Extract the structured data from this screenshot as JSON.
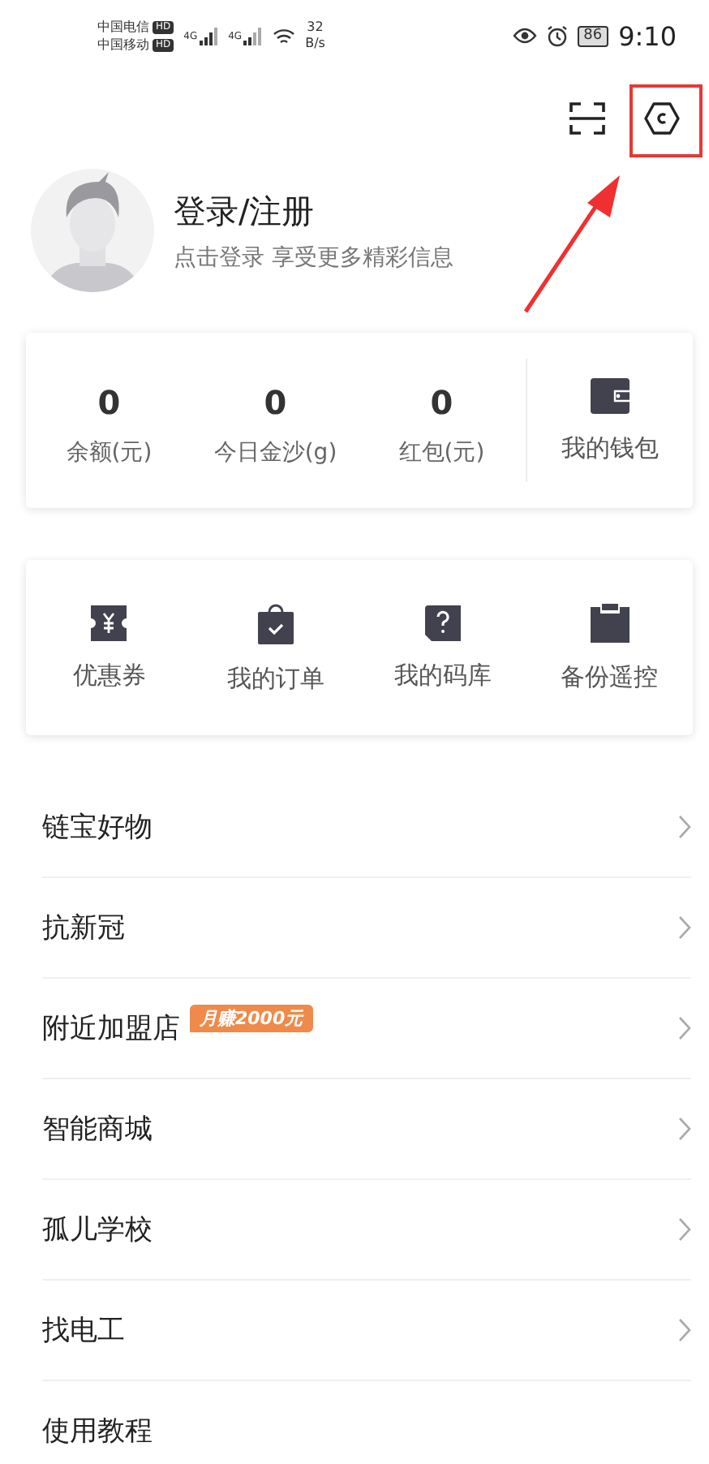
{
  "status_bar": {
    "carriers": [
      {
        "name": "中国电信",
        "badge": "HD"
      },
      {
        "name": "中国移动",
        "badge": "HD"
      }
    ],
    "signals": [
      "4G",
      "4G"
    ],
    "speed_value": "32",
    "speed_unit": "B/s",
    "battery": "86",
    "time": "9:10"
  },
  "profile": {
    "title": "登录/注册",
    "subtitle": "点击登录 享受更多精彩信息"
  },
  "stats": [
    {
      "value": "0",
      "label": "余额(元)"
    },
    {
      "value": "0",
      "label": "今日金沙(g)"
    },
    {
      "value": "0",
      "label": "红包(元)"
    }
  ],
  "wallet": {
    "label": "我的钱包"
  },
  "shortcuts": [
    {
      "kind": "coupon",
      "label": "优惠券"
    },
    {
      "kind": "order",
      "label": "我的订单"
    },
    {
      "kind": "code",
      "label": "我的码库"
    },
    {
      "kind": "backup",
      "label": "备份遥控"
    }
  ],
  "menu": [
    {
      "label": "链宝好物"
    },
    {
      "label": "抗新冠"
    },
    {
      "label": "附近加盟店",
      "tag": "月赚2000元"
    },
    {
      "label": "智能商城"
    },
    {
      "label": "孤儿学校"
    },
    {
      "label": "找电工"
    },
    {
      "label": "使用教程",
      "chevron": false
    }
  ],
  "annotation": {
    "settings_highlighted": true
  }
}
